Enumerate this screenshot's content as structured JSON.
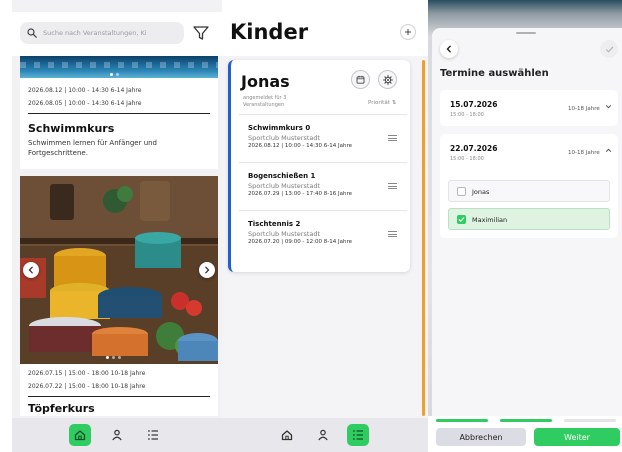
{
  "colors": {
    "accent_green": "#2ecc61",
    "accent_blue": "#1f5fd1",
    "accent_orange": "#f0a028"
  },
  "events": {
    "search": {
      "placeholder": "Suche nach Veranstaltungen, Ki",
      "icon": "search-icon"
    },
    "filter_icon": "filter-icon",
    "cards": [
      {
        "meta": [
          "2026.08.12 | 10:00 - 14:30 6-14 Jahre",
          "2026.08.05 | 10:00 - 14:30 6-14 Jahre"
        ],
        "title": "Schwimmkurs",
        "description": "Schwimmen lernen für Anfänger und Fortgeschrittene."
      },
      {
        "meta": [
          "2026.07.15 | 15:00 - 18:00 10-18 Jahre",
          "2026.07.22 | 15:00 - 18:00 10-18 Jahre"
        ],
        "title": "Töpferkurs"
      }
    ],
    "nav": [
      "home-icon",
      "person-icon",
      "list-icon"
    ],
    "nav_active": "home-icon"
  },
  "kids": {
    "title": "Kinder",
    "add_icon": "plus-icon",
    "child": {
      "name": "Jonas",
      "registered": "angemeldet für 3 Veranstaltungen",
      "priority_label": "Priorität ⇅",
      "courses": [
        {
          "title": "Schwimmkurs 0",
          "club": "Sportclub Musterstadt",
          "meta": "2026.08.12 | 10:00 - 14:30 6-14 Jahre"
        },
        {
          "title": "Bogenschießen 1",
          "club": "Sportclub Musterstadt",
          "meta": "2026.07.29 | 13:00 - 17:40 8-16 Jahre"
        },
        {
          "title": "Tischtennis 2",
          "club": "Sportclub Musterstadt",
          "meta": "2026.07.20 | 09:00 - 12:00 8-14 Jahre"
        }
      ]
    },
    "nav_active": "list-icon"
  },
  "booking": {
    "title": "Termine auswählen",
    "dates": [
      {
        "date": "15.07.2026",
        "time": "15:00 - 18:00",
        "age": "10-18 Jahre",
        "expanded": false
      },
      {
        "date": "22.07.2026",
        "time": "15:00 - 18:00",
        "age": "10-18 Jahre",
        "expanded": true,
        "options": [
          {
            "label": "Jonas",
            "checked": false
          },
          {
            "label": "Maximilian",
            "checked": true
          }
        ]
      }
    ],
    "cancel_label": "Abbrechen",
    "next_label": "Weiter",
    "progress_steps": 3,
    "progress_done": 2
  }
}
